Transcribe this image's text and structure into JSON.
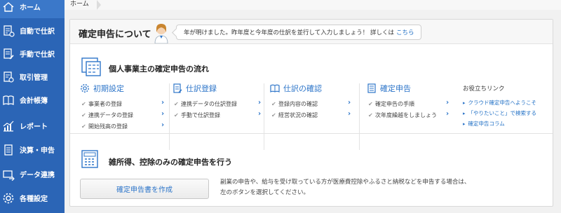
{
  "sidebar": {
    "items": [
      {
        "label": "ホーム",
        "icon": "home-icon"
      },
      {
        "label": "自動で仕訳",
        "icon": "auto-journal-icon"
      },
      {
        "label": "手動で仕訳",
        "icon": "manual-journal-icon"
      },
      {
        "label": "取引管理",
        "icon": "transaction-icon"
      },
      {
        "label": "会計帳簿",
        "icon": "ledger-icon"
      },
      {
        "label": "レポート",
        "icon": "report-icon"
      },
      {
        "label": "決算・申告",
        "icon": "settlement-icon"
      },
      {
        "label": "データ連携",
        "icon": "data-link-icon"
      },
      {
        "label": "各種設定",
        "icon": "settings-icon"
      }
    ],
    "colors": {
      "background": "#2b65b6",
      "active": "#3b78c9"
    }
  },
  "breadcrumb": {
    "home": "ホーム"
  },
  "panel": {
    "title": "確定申告について",
    "bubble_text": "年が明けました。昨年度と今年度の仕訳を並行して入力しましょう！ 詳しくは",
    "bubble_link": "こちら",
    "flow_title": "個人事業主の確定申告の流れ",
    "columns": [
      {
        "title": "初期設定",
        "icon": "gear-icon",
        "items": [
          "事業者の登録",
          "連携データの登録",
          "開始残高の登録"
        ]
      },
      {
        "title": "仕訳登録",
        "icon": "journal-icon",
        "items": [
          "連携データの仕訳登録",
          "手動で仕訳登録"
        ]
      },
      {
        "title": "仕訳の確認",
        "icon": "book-icon",
        "items": [
          "登録内容の確認",
          "経営状況の確認"
        ]
      },
      {
        "title": "確定申告",
        "icon": "document-icon",
        "items": [
          "確定申告の手順",
          "次年度繰越をしましょう"
        ]
      }
    ],
    "help": {
      "title": "お役立ちリンク",
      "links": [
        "クラウド確定申告へようこそ",
        "「やりたいこと」で検索する",
        "確定申告コラム"
      ]
    },
    "misc_title": "雑所得、控除のみの確定申告を行う",
    "create_button": "確定申告書を作成",
    "desc_line1": "副業の申告や、給与を受け取っている方が医療費控除やふるさと納税などを申告する場合は、",
    "desc_line2": "左のボタンを選択してください。",
    "accent": "#2d75c9"
  }
}
